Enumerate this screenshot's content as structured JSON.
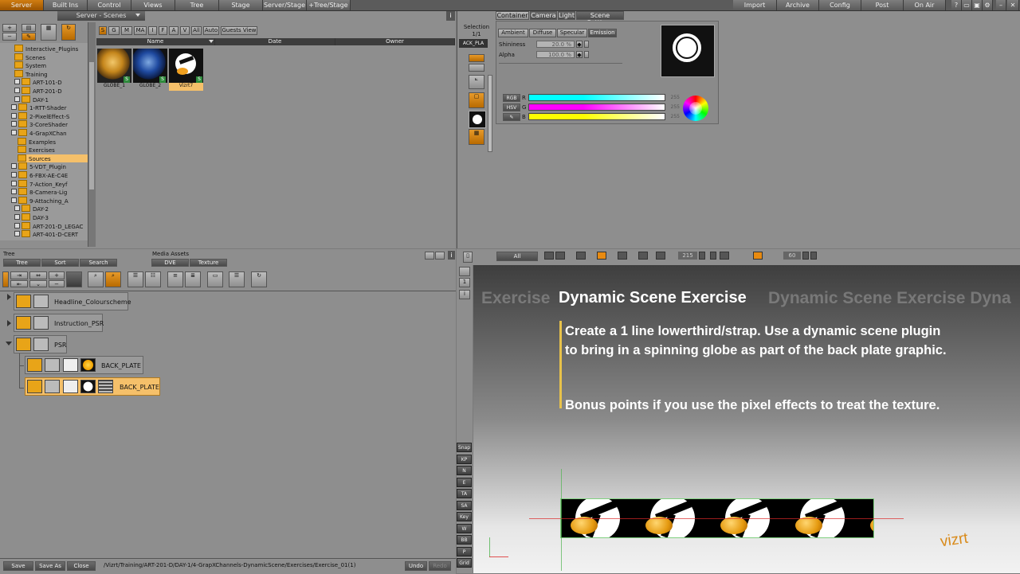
{
  "menubar": {
    "left": [
      "Server",
      "Built Ins",
      "Control",
      "Views",
      "Tree",
      "Stage",
      "Server/Stage",
      "+Tree/Stage"
    ],
    "right": [
      "Import",
      "Archive",
      "Config",
      "Post",
      "On Air"
    ]
  },
  "server_panel": {
    "title": "Server - Scenes",
    "filters": [
      "S",
      "G",
      "M",
      "MA",
      "I",
      "F",
      "A",
      "V",
      "All",
      "Auto",
      "Guests View"
    ],
    "columns": [
      "Name",
      "Date",
      "Owner"
    ],
    "tree": [
      {
        "label": "Interactive_Plugins",
        "depth": 1
      },
      {
        "label": "Scenes",
        "depth": 1
      },
      {
        "label": "System",
        "depth": 1
      },
      {
        "label": "Training",
        "depth": 1
      },
      {
        "label": "ART-101-D",
        "depth": 2
      },
      {
        "label": "ART-201-D",
        "depth": 2
      },
      {
        "label": "DAY-1",
        "depth": 3
      },
      {
        "label": "1-RTT-Shader",
        "depth": 4
      },
      {
        "label": "2-PixelEffect-S",
        "depth": 4
      },
      {
        "label": "3-CoreShader",
        "depth": 4
      },
      {
        "label": "4-GrapXChan",
        "depth": 4
      },
      {
        "label": "Examples",
        "depth": 5
      },
      {
        "label": "Exercises",
        "depth": 5
      },
      {
        "label": "Sources",
        "depth": 5,
        "selected": true
      },
      {
        "label": "5-VDT_Plugin",
        "depth": 4
      },
      {
        "label": "6-FBX-AE-C4E",
        "depth": 4
      },
      {
        "label": "7-Action_Keyf",
        "depth": 4
      },
      {
        "label": "8-Camera-Lig",
        "depth": 4
      },
      {
        "label": "9-Attaching_A",
        "depth": 4
      },
      {
        "label": "DAY-2",
        "depth": 3
      },
      {
        "label": "DAY-3",
        "depth": 3
      },
      {
        "label": "ART-201-D_LEGAC",
        "depth": 2
      },
      {
        "label": "ART-401-D-CERT",
        "depth": 2
      }
    ],
    "thumbs": [
      {
        "label": "GLOBE_1"
      },
      {
        "label": "GLOBE_2"
      },
      {
        "label": "Vizrt7"
      }
    ]
  },
  "selection": {
    "title": "Selection",
    "count": "1/1",
    "node": "ACK_PLA"
  },
  "editor": {
    "tabs": [
      "Container",
      "Camera",
      "Light",
      "Scene Settings"
    ],
    "material_tabs": [
      "Ambient",
      "Diffuse",
      "Specular",
      "Emission"
    ],
    "shininess_label": "Shininess",
    "shininess_value": "20.0 %",
    "alpha_label": "Alpha",
    "alpha_value": "100.0 %",
    "modes": [
      "RGB",
      "HSV",
      ""
    ],
    "channels": [
      {
        "name": "R",
        "value": "255",
        "color": "#00ffff"
      },
      {
        "name": "G",
        "value": "255",
        "color": "#ff00ff"
      },
      {
        "name": "B",
        "value": "255",
        "color": "#ffff00"
      }
    ]
  },
  "tree_panel": {
    "label": "Tree",
    "tabs": [
      "Tree",
      "Sort",
      "Search"
    ],
    "media_label": "Media Assets",
    "media_tabs": [
      "DVE",
      "Texture"
    ],
    "nodes": [
      {
        "label": "Headline_Colourscheme"
      },
      {
        "label": "Instruction_PSR"
      },
      {
        "label": "PSR"
      },
      {
        "label": "BACK_PLATE"
      },
      {
        "label": "BACK_PLATE",
        "selected": true
      }
    ]
  },
  "timeline": {
    "all": "All",
    "frame": "215",
    "fps": "60"
  },
  "side_buttons": [
    "Snap",
    "KP",
    "N",
    "E",
    "TA",
    "SA",
    "Key",
    "W",
    "BB",
    "P",
    "Grid"
  ],
  "preview": {
    "bg_text": "Exercise",
    "bg_text_right": "Dynamic Scene Exercise Dyna",
    "title": "Dynamic Scene Exercise",
    "body1": "Create a 1 line lowerthird/strap. Use a dynamic scene plugin to bring in a spinning globe as part of the back plate graphic.",
    "body2": "Bonus points if you use the pixel effects to treat the texture.",
    "logo": "vizrt"
  },
  "statusbar": {
    "save": "Save",
    "save_as": "Save As",
    "close": "Close",
    "path": "/Vizrt/Training/ART-201-D/DAY-1/4-GrapXChannels-DynamicScene/Exercises/Exercise_01(1)",
    "undo": "Undo",
    "redo": "Redo"
  }
}
